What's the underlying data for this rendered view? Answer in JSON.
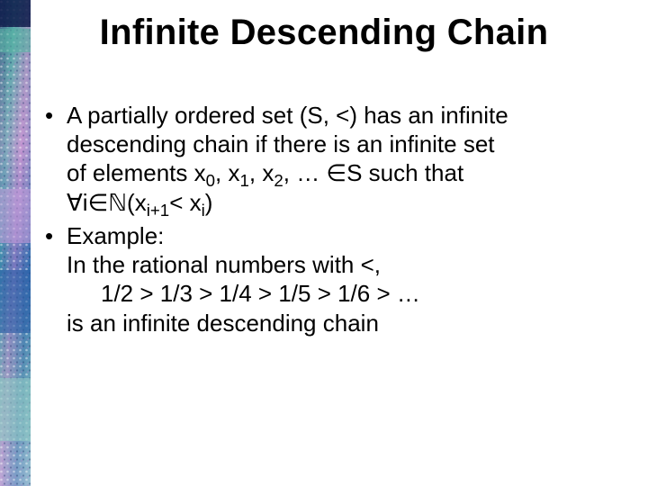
{
  "title": "Infinite Descending Chain",
  "bullets": {
    "b1": {
      "l1": "A partially ordered set (S, <) has an infinite",
      "l2": "descending chain if there is an infinite set",
      "l3_pre": "of elements x",
      "l3_s0": "0",
      "l3_m1": ", x",
      "l3_s1": "1",
      "l3_m2": ", x",
      "l3_s2": "2",
      "l3_post": ", … ∈S such that",
      "l4_pre": "∀i∈",
      "l4_N": "ℕ",
      "l4_mid1": "(x",
      "l4_sip1": "i+1",
      "l4_mid2": "< x",
      "l4_si": "i",
      "l4_post": ")"
    },
    "b2": {
      "l1": "Example:",
      "l2": "In the rational numbers with <,",
      "l3": "1/2 > 1/3 > 1/4 > 1/5 > 1/6 > …",
      "l4": "is an infinite descending chain"
    }
  }
}
